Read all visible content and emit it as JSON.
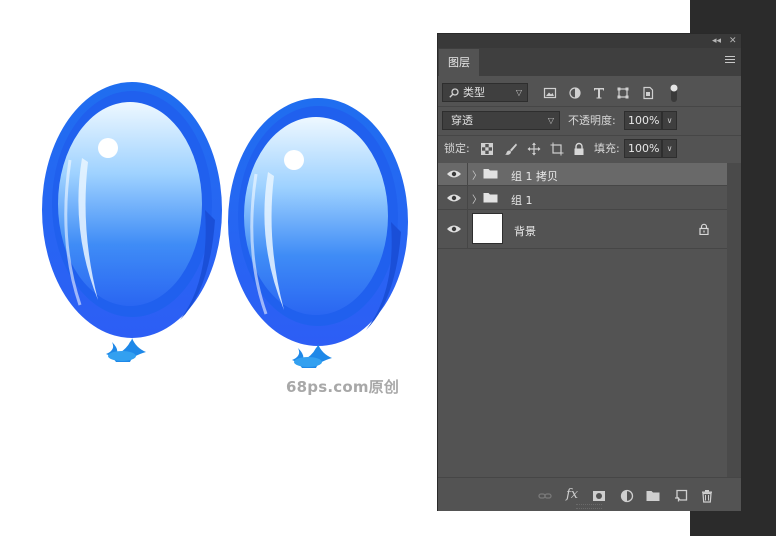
{
  "canvas": {
    "watermark": "68ps.com原创"
  },
  "panel": {
    "tab_label": "图层",
    "filter": {
      "value": "类型",
      "icon": "search-icon"
    },
    "blend_mode": "穿透",
    "opacity": {
      "label": "不透明度:",
      "value": "100%"
    },
    "lock": {
      "label": "锁定:"
    },
    "fill": {
      "label": "填充:",
      "value": "100%"
    },
    "layers": [
      {
        "name": "组 1 拷贝",
        "type": "group",
        "selected": true
      },
      {
        "name": "组 1",
        "type": "group",
        "selected": false
      },
      {
        "name": "背景",
        "type": "background",
        "locked": true,
        "selected": false
      }
    ]
  },
  "colors": {
    "panel_bg": "#535353",
    "selected_row": "#696969",
    "balloon_blue": "#2f7cf4"
  }
}
